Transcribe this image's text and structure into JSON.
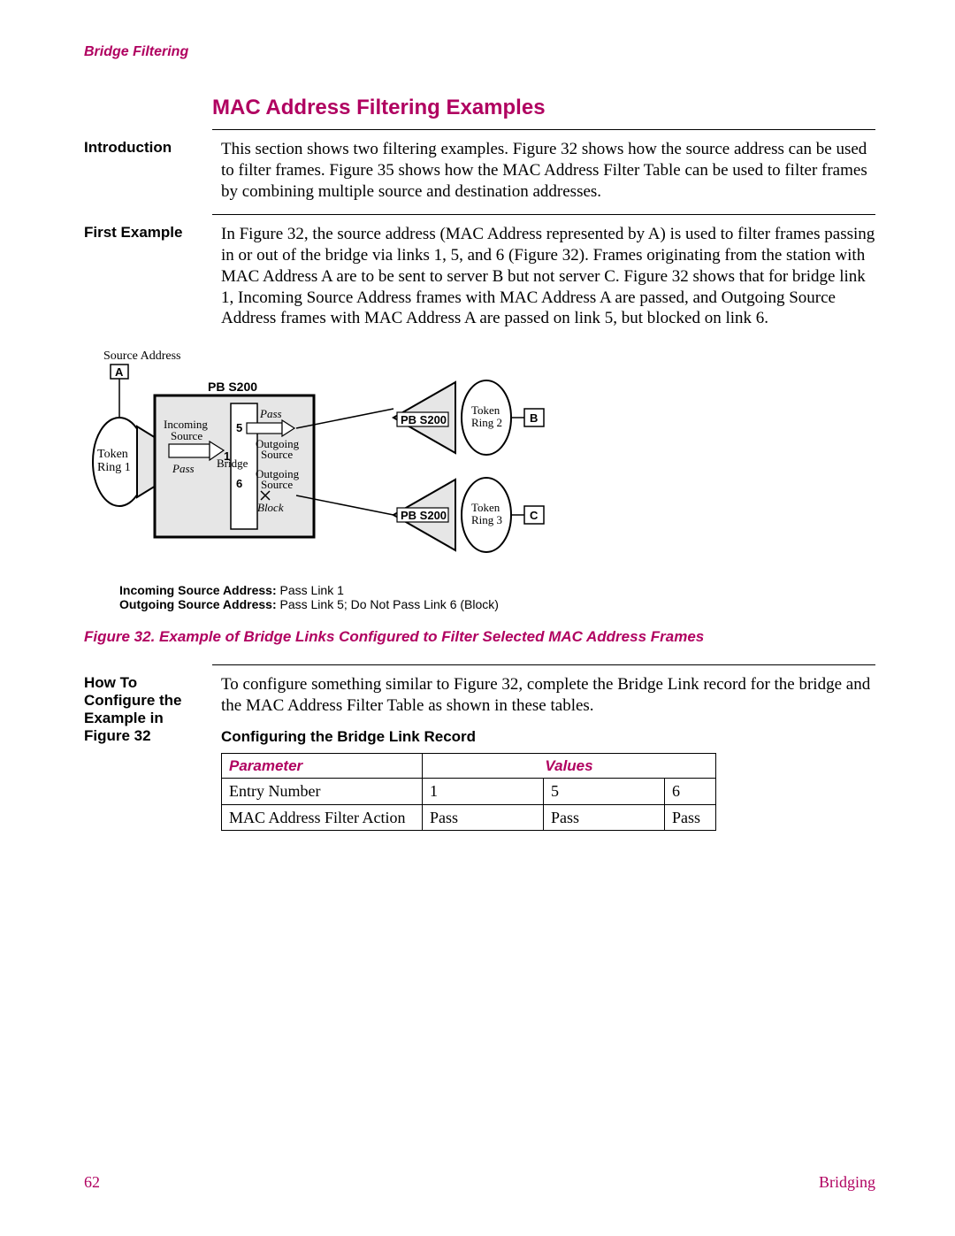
{
  "header": "Bridge Filtering",
  "title": "MAC Address Filtering Examples",
  "sections": {
    "intro_label": "Introduction",
    "intro_text": "This section shows two filtering examples. Figure 32 shows how the source address can be used to filter frames. Figure 35 shows how the MAC Address Filter Table can be used to filter frames by combining multiple source and destination addresses.",
    "first_label": "First Example",
    "first_text": "In Figure 32, the source address (MAC Address represented by A) is used to filter frames passing in or out of the bridge via links 1, 5, and 6 (Figure 32). Frames originating from the station with MAC Address A are to be sent to server B but not server C. Figure 32 shows that for bridge link 1, Incoming Source Address frames with MAC Address A are passed, and Outgoing Source Address frames with MAC Address A are passed on link 5, but blocked on link 6.",
    "howto_label": "How To Configure the Example in Figure 32",
    "howto_text": "To configure something similar to Figure 32, complete the Bridge Link record for the bridge and the MAC Address Filter Table as shown in these tables.",
    "config_heading": "Configuring the Bridge Link Record"
  },
  "diagram": {
    "source_address": "Source Address",
    "node_a": "A",
    "pb_s200_top": "PB S200",
    "pb_s200_r1": "PB S200",
    "pb_s200_r2": "PB S200",
    "token_ring_1": "Token Ring 1",
    "token_ring_2": "Token Ring 2",
    "token_ring_3": "Token Ring 3",
    "node_b": "B",
    "node_c": "C",
    "incoming_source": "Incoming Source",
    "outgoing_source_1": "Outgoing Source",
    "outgoing_source_2": "Outgoing Source",
    "bridge": "Bridge",
    "pass1": "Pass",
    "pass2": "Pass",
    "block": "Block",
    "num1": "1",
    "num5": "5",
    "num6": "6",
    "caption_line1_b": "Incoming Source Address:",
    "caption_line1_t": " Pass Link 1",
    "caption_line2_b": "Outgoing Source Address:",
    "caption_line2_t": " Pass Link 5; Do Not Pass Link 6 (Block)"
  },
  "figure_caption": "Figure 32. Example of Bridge Links Configured to Filter Selected MAC Address Frames",
  "table": {
    "h_param": "Parameter",
    "h_values": "Values",
    "r1c1": "Entry Number",
    "r1c2": "1",
    "r1c3": "5",
    "r1c4": "6",
    "r2c1": "MAC Address Filter Action",
    "r2c2": "Pass",
    "r2c3": "Pass",
    "r2c4": "Pass"
  },
  "footer": {
    "page": "62",
    "section": "Bridging"
  }
}
